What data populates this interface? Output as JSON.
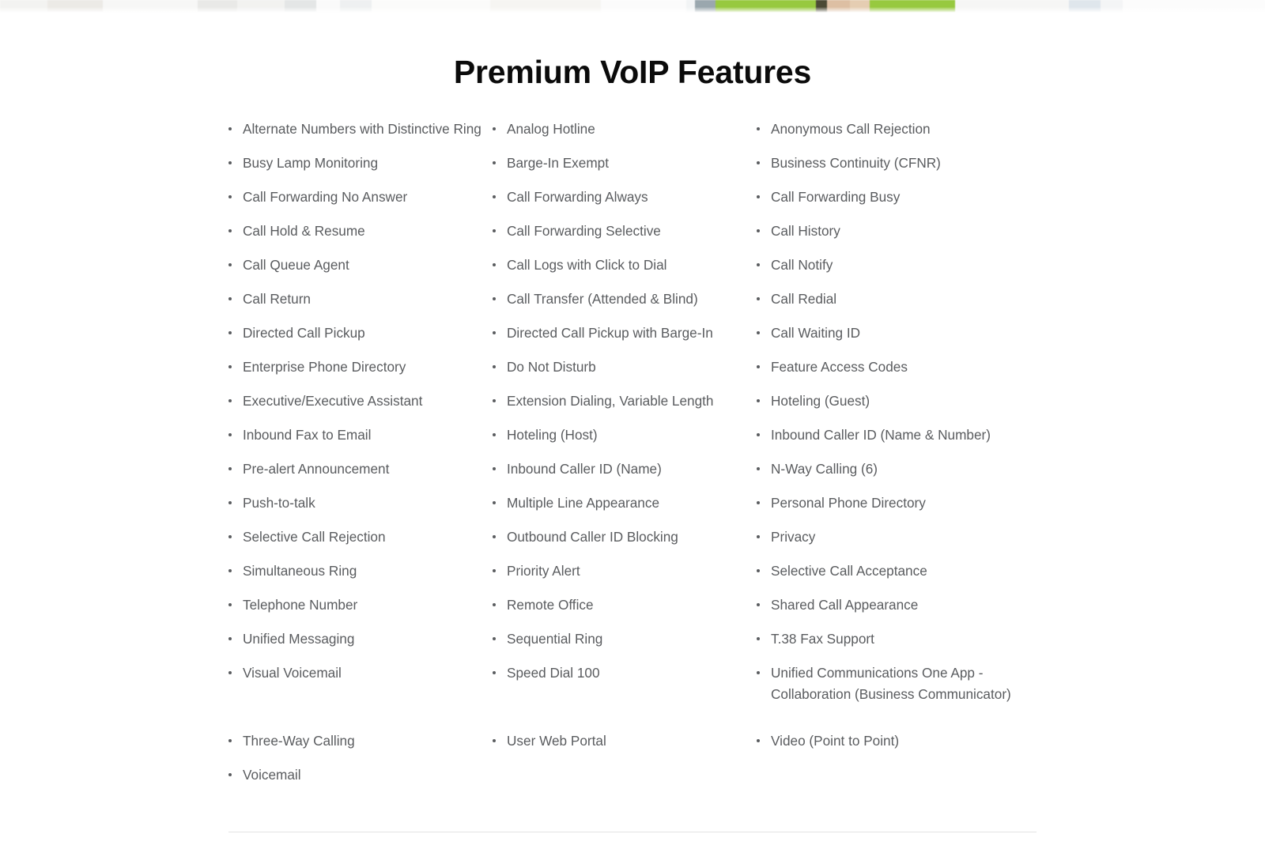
{
  "hero": {
    "alt": "blurred banner photo of person in green shirt"
  },
  "section": {
    "title": "Premium VoIP Features"
  },
  "columns": [
    {
      "name": "column-1",
      "items": [
        "Alternate Numbers with Distinctive Ring",
        "Busy Lamp Monitoring",
        "Call Forwarding No Answer",
        "Call Hold & Resume",
        "Call Queue Agent",
        "Call Return",
        "Directed Call Pickup",
        "Enterprise Phone Directory",
        "Executive/Executive Assistant",
        "Inbound Fax to Email",
        "Pre-alert Announcement",
        "Push-to-talk",
        "Selective Call Rejection",
        "Simultaneous Ring",
        "Telephone Number",
        "Unified Messaging",
        "Visual Voicemail",
        "",
        "Three-Way Calling",
        "Voicemail"
      ]
    },
    {
      "name": "column-2",
      "items": [
        "Analog Hotline",
        "Barge-In Exempt",
        "Call Forwarding Always",
        "Call Forwarding Selective",
        "Call Logs with Click to Dial",
        "Call Transfer (Attended & Blind)",
        "Directed Call Pickup with Barge-In",
        "Do Not Disturb",
        "Extension Dialing, Variable Length",
        "Hoteling (Host)",
        "Inbound Caller ID (Name)",
        "Multiple Line Appearance",
        "Outbound Caller ID Blocking",
        "Priority Alert",
        "Remote Office",
        "Sequential Ring",
        "Speed Dial 100",
        "",
        "User Web Portal"
      ]
    },
    {
      "name": "column-3",
      "items": [
        "Anonymous Call Rejection",
        "Business Continuity (CFNR)",
        "Call Forwarding Busy",
        "Call History",
        "Call Notify",
        "Call Redial",
        "Call Waiting ID",
        "Feature Access Codes",
        "Hoteling (Guest)",
        "Inbound Caller ID (Name & Number)",
        "N-Way Calling (6)",
        "Personal Phone Directory",
        "Privacy",
        "Selective Call Acceptance",
        "Shared Call Appearance",
        "T.38 Fax Support",
        "Unified Communications One App - Collaboration (Business Communicator)",
        "Video (Point to Point)"
      ]
    }
  ],
  "colors": {
    "title": "#0b0b0b",
    "body_text": "#5a5c5f",
    "divider": "#e3e3e3",
    "page_background": "#ffffff",
    "hero_accent_green": "#97c93f"
  }
}
